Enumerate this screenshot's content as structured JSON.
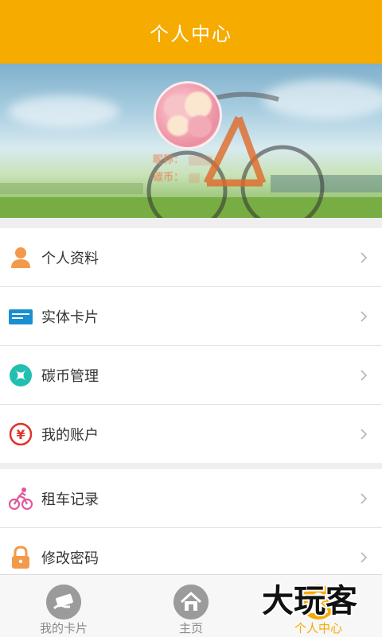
{
  "header": {
    "title": "个人中心"
  },
  "profile": {
    "nickname_label": "昵称：",
    "coins_label": "碳币："
  },
  "menu_group_1": [
    {
      "label": "个人资料",
      "icon": "person-icon",
      "color": "#f39a4a"
    },
    {
      "label": "实体卡片",
      "icon": "card-icon",
      "color": "#1a8fd0"
    },
    {
      "label": "碳币管理",
      "icon": "coin-icon",
      "color": "#22bfb0"
    },
    {
      "label": "我的账户",
      "icon": "yen-icon",
      "color": "#e2322a"
    }
  ],
  "menu_group_2": [
    {
      "label": "租车记录",
      "icon": "cyclist-icon",
      "color": "#e0589b"
    },
    {
      "label": "修改密码",
      "icon": "lock-icon",
      "color": "#f39a4a"
    }
  ],
  "tabbar": {
    "tabs": [
      {
        "label": "我的卡片",
        "icon": "card-hand-icon",
        "active": false
      },
      {
        "label": "主页",
        "icon": "home-icon",
        "active": false
      },
      {
        "label": "个人中心",
        "icon": "person-center-icon",
        "active": true
      }
    ]
  },
  "watermark": {
    "text": "大玩客"
  },
  "colors": {
    "accent": "#f6ab00",
    "inactive": "#8a8a8a"
  }
}
